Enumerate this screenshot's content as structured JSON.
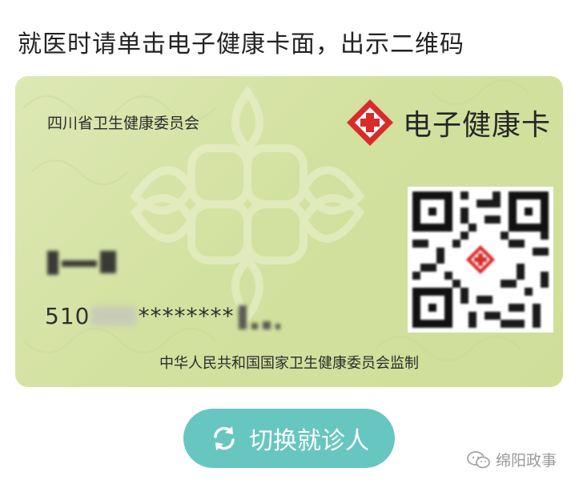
{
  "instruction": "就医时请单击电子健康卡面，出示二维码",
  "card": {
    "issuer": "四川省卫生健康委员会",
    "brand_title": "电子健康卡",
    "logo_icon": "red-cross-diamond-icon",
    "name_masked": true,
    "id_prefix": "510",
    "id_masked": "********",
    "qr_icon": "qr-code-icon",
    "supervisor": "中华人民共和国国家卫生健康委员会监制",
    "accent_color": "#d8e6a8"
  },
  "switch_button": {
    "label": "切换就诊人",
    "icon": "refresh-icon",
    "color": "#67c6c0"
  },
  "watermark": {
    "text": "绵阳政事",
    "icon": "wechat-icon"
  }
}
